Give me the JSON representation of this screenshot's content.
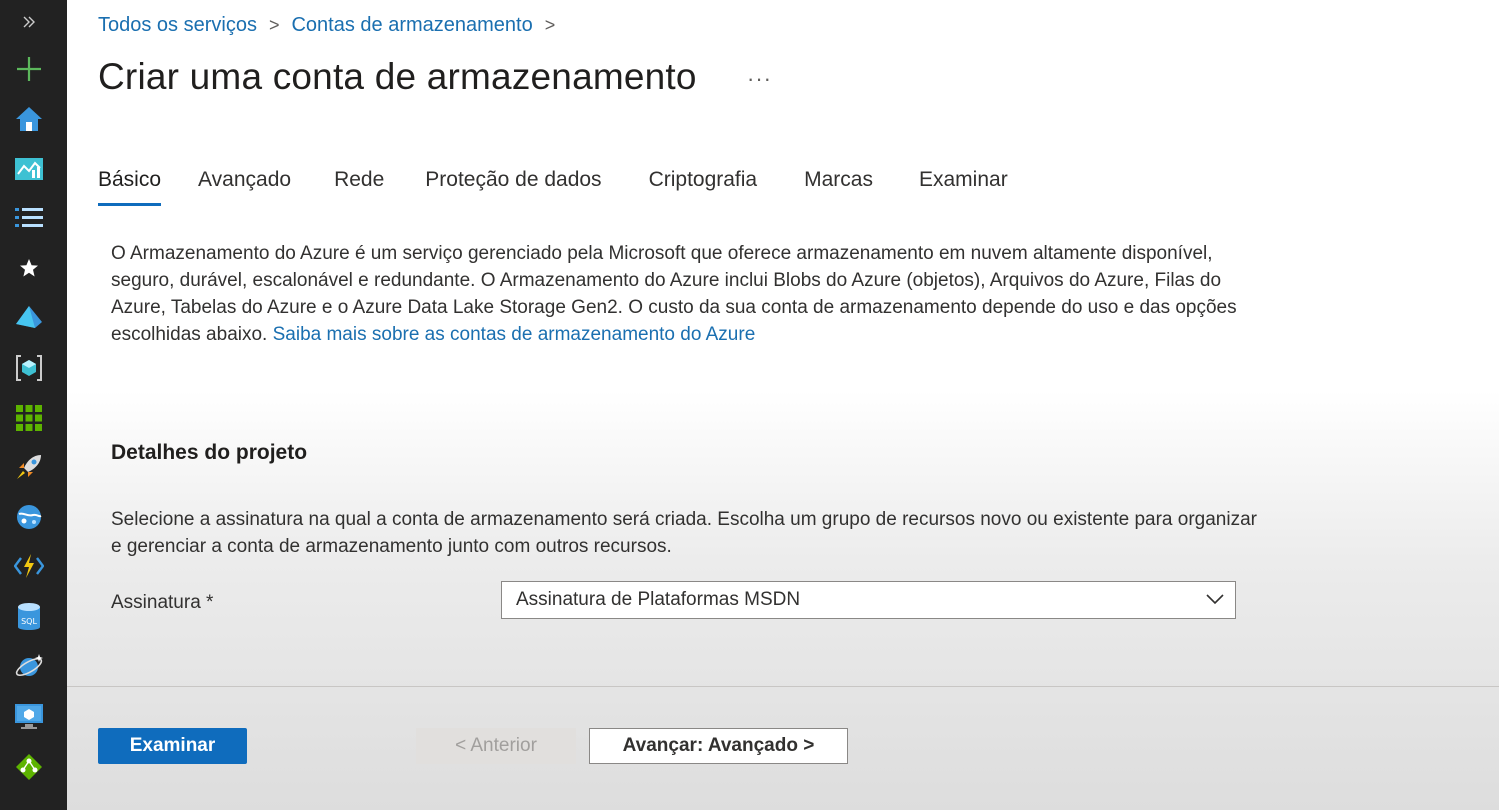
{
  "sidebar": {
    "items": [
      {
        "icon": "double-chevron-right-icon",
        "color": "#cccccc"
      },
      {
        "icon": "plus-icon",
        "color": "#5cb85c"
      },
      {
        "icon": "home-icon",
        "color": "#3a96dd"
      },
      {
        "icon": "dashboard-icon",
        "color": "#3ec1d3"
      },
      {
        "icon": "all-services-list-icon",
        "color": "#b9e0ff"
      },
      {
        "icon": "star-icon",
        "color": "#ffffff"
      },
      {
        "icon": "azure-devops-icon",
        "color": "#3a96dd"
      },
      {
        "icon": "resource-group-icon",
        "color": "#3ec1d3"
      },
      {
        "icon": "all-resources-grid-icon",
        "color": "#5db300"
      },
      {
        "icon": "quickstart-rocket-icon",
        "color": "#f08a24"
      },
      {
        "icon": "app-services-globe-icon",
        "color": "#3a96dd"
      },
      {
        "icon": "function-app-icon",
        "color": "#f2c811"
      },
      {
        "icon": "sql-database-icon",
        "color": "#3a96dd"
      },
      {
        "icon": "cosmos-db-icon",
        "color": "#3a96dd"
      },
      {
        "icon": "virtual-machine-icon",
        "color": "#3a96dd"
      },
      {
        "icon": "load-balancer-icon",
        "color": "#5db300"
      }
    ]
  },
  "breadcrumb": {
    "items": [
      "Todos os serviços",
      "Contas de armazenamento"
    ],
    "separator": ">"
  },
  "page": {
    "title": "Criar uma conta de armazenamento",
    "more": "···"
  },
  "tabs": [
    {
      "label": "Básico",
      "active": true
    },
    {
      "label": "Avançado",
      "active": false
    },
    {
      "label": "Rede",
      "active": false
    },
    {
      "label": "Proteção de dados",
      "active": false
    },
    {
      "label": "Criptografia",
      "active": false
    },
    {
      "label": "Marcas",
      "active": false
    },
    {
      "label": "Examinar",
      "active": false
    }
  ],
  "intro": {
    "text": "O Armazenamento do Azure é um serviço gerenciado pela Microsoft que oferece armazenamento em nuvem altamente disponível, seguro, durável, escalonável e redundante. O Armazenamento do Azure inclui Blobs do Azure (objetos), Arquivos do Azure, Filas do Azure, Tabelas do Azure e o Azure Data Lake Storage Gen2. O custo da sua conta de armazenamento depende do uso e das opções escolhidas abaixo.",
    "link": "Saiba mais sobre as contas de armazenamento do Azure"
  },
  "project_details": {
    "title": "Detalhes do projeto",
    "description": "Selecione a assinatura na qual a conta de armazenamento será criada. Escolha um grupo de recursos novo ou existente para organizar e gerenciar a conta de armazenamento junto com outros recursos.",
    "subscription_label": "Assinatura *",
    "subscription_value": "Assinatura de Plataformas MSDN"
  },
  "footer": {
    "review_label": "Examinar",
    "previous_label": "< Anterior",
    "next_label": "Avançar: Avançado >"
  },
  "colors": {
    "accent": "#0f6cbd",
    "link": "#1a6fb0",
    "sidebar_bg": "#222222"
  }
}
